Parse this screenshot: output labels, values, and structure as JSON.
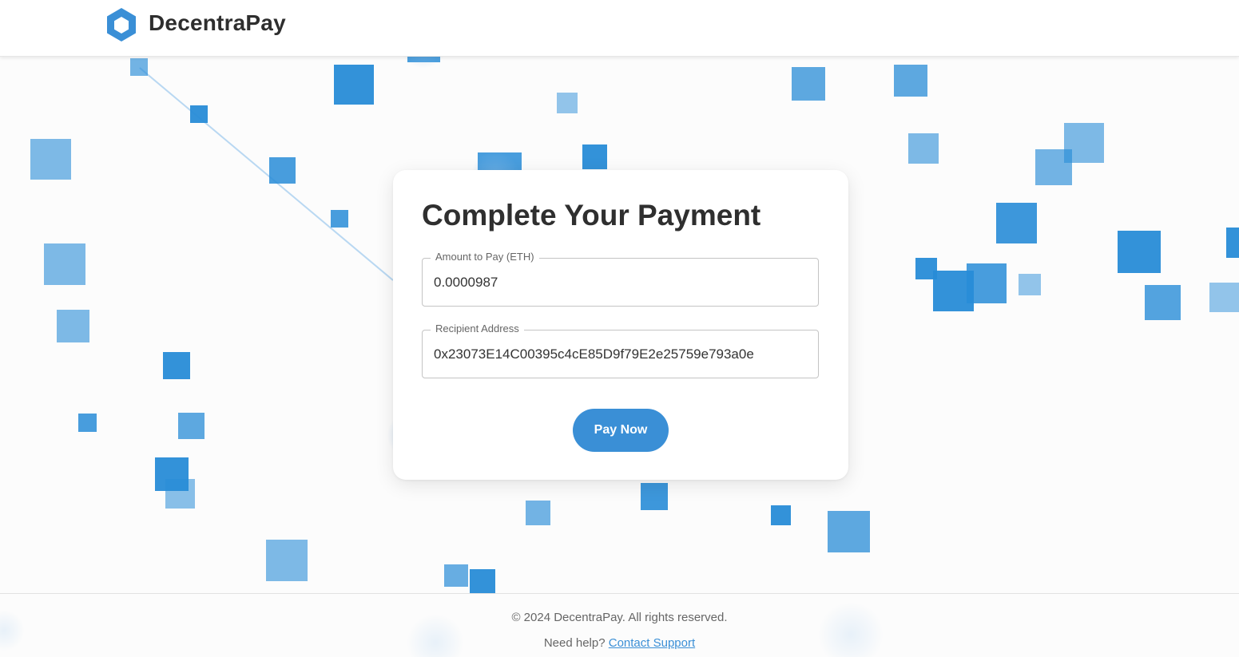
{
  "brand": {
    "name": "DecentraPay",
    "logo_icon": "hexagon-logo-icon",
    "color": "#3a8fd6"
  },
  "payment": {
    "title": "Complete Your Payment",
    "amount_label": "Amount to Pay (ETH)",
    "amount_value": "0.0000987",
    "address_label": "Recipient Address",
    "address_value": "0x23073E14C00395c4cE85D9f79E2e25759e793a0e",
    "pay_button_label": "Pay Now"
  },
  "footer": {
    "copyright": "© 2024 DecentraPay. All rights reserved.",
    "help_prefix": "Need help? ",
    "contact_link": "Contact Support"
  },
  "colors": {
    "accent": "#3a8fd6",
    "background": "#fcfcfc",
    "card": "#ffffff",
    "text": "#2f2f2f"
  }
}
